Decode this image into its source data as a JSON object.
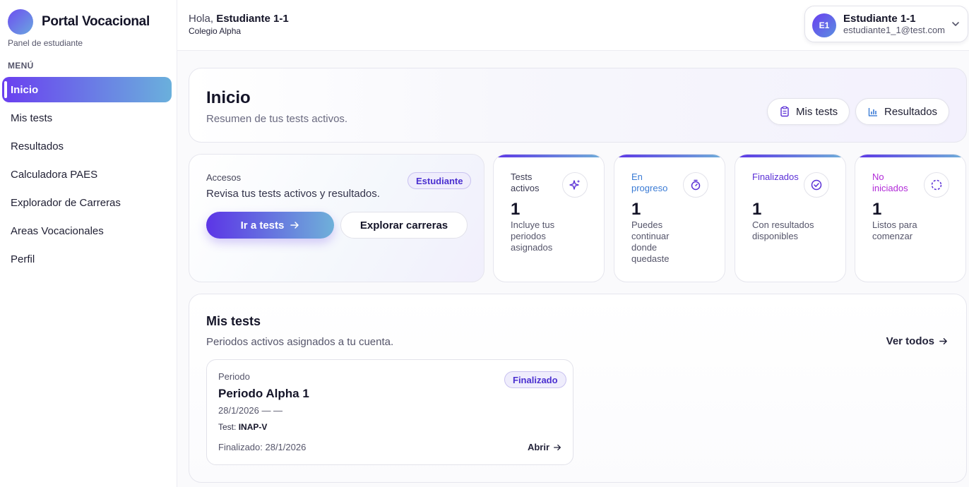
{
  "brand": {
    "title": "Portal Vocacional",
    "subtitle": "Panel de estudiante"
  },
  "sidebar": {
    "menu_label": "MENÚ",
    "items": [
      {
        "label": "Inicio",
        "active": true
      },
      {
        "label": "Mis tests"
      },
      {
        "label": "Resultados"
      },
      {
        "label": "Calculadora PAES"
      },
      {
        "label": "Explorador de Carreras"
      },
      {
        "label": "Areas Vocacionales"
      },
      {
        "label": "Perfil"
      }
    ]
  },
  "topbar": {
    "greeting_prefix": "Hola,",
    "greeting_name": "Estudiante 1-1",
    "school": "Colegio Alpha",
    "user": {
      "initials": "E1",
      "name": "Estudiante 1-1",
      "email": "estudiante1_1@test.com"
    }
  },
  "header": {
    "title": "Inicio",
    "subtitle": "Resumen de tus tests activos.",
    "buttons": {
      "tests": "Mis tests",
      "results": "Resultados"
    }
  },
  "accesos": {
    "label": "Accesos",
    "badge": "Estudiante",
    "text": "Revisa tus tests activos y resultados.",
    "primary": "Ir a tests",
    "secondary": "Explorar carreras"
  },
  "stats": [
    {
      "label": "Tests activos",
      "value": "1",
      "desc": "Incluye tus periodos asignados",
      "color": "#3a3a52",
      "icon": "sparkles-icon"
    },
    {
      "label": "En progreso",
      "value": "1",
      "desc": "Puedes continuar donde quedaste",
      "color": "#3a7bd5",
      "icon": "timer-icon"
    },
    {
      "label": "Finalizados",
      "value": "1",
      "desc": "Con resultados disponibles",
      "color": "#5a2fd6",
      "icon": "check-circle-icon"
    },
    {
      "label": "No iniciados",
      "value": "1",
      "desc": "Listos para comenzar",
      "color": "#b12ad8",
      "icon": "dashed-circle-icon"
    }
  ],
  "tests": {
    "title": "Mis tests",
    "subtitle": "Periodos activos asignados a tu cuenta.",
    "see_all": "Ver todos",
    "period": {
      "label": "Periodo",
      "name": "Periodo Alpha 1",
      "badge": "Finalizado",
      "date": "28/1/2026 — —",
      "test_prefix": "Test:",
      "test_name": "INAP-V",
      "finalized": "Finalizado: 28/1/2026",
      "open": "Abrir"
    }
  },
  "colors": {
    "accent_start": "#5c35e6",
    "accent_end": "#6fb0d9",
    "badge_text": "#4a2fd0"
  }
}
